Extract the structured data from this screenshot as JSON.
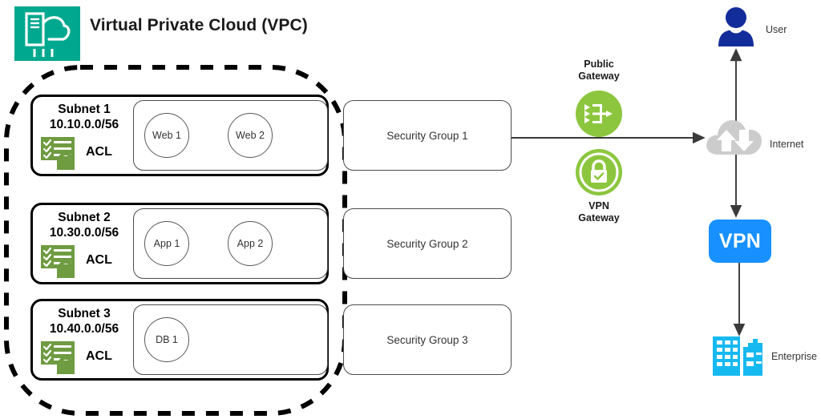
{
  "diagram": {
    "title": "Virtual Private Cloud (VPC)",
    "vpc_icon": "vpc-cloud-server-icon",
    "colors": {
      "vpc_teal": "#00A88F",
      "gateway_green": "#8CC63E",
      "acl_green": "#6F9B41",
      "vpn_blue": "#1890FF",
      "user_navy": "#122C9A",
      "enterprise_cyan": "#16B9F0",
      "internet_gray": "#CCCCCC",
      "stroke_black": "#000000"
    },
    "subnets": [
      {
        "name": "Subnet 1",
        "cidr": "10.10.0.0/56",
        "acl_label": "ACL",
        "acl_icon": "acl-checklist-lock-icon",
        "instances": [
          "Web 1",
          "Web 2"
        ],
        "security_group": "Security Group 1"
      },
      {
        "name": "Subnet 2",
        "cidr": "10.30.0.0/56",
        "acl_label": "ACL",
        "acl_icon": "acl-checklist-lock-icon",
        "instances": [
          "App 1",
          "App 2"
        ],
        "security_group": "Security Group 2"
      },
      {
        "name": "Subnet 3",
        "cidr": "10.40.0.0/56",
        "acl_label": "ACL",
        "acl_icon": "acl-checklist-lock-icon",
        "instances": [
          "DB 1"
        ],
        "security_group": "Security Group 3"
      }
    ],
    "gateways": [
      {
        "label_line1": "Public",
        "label_line2": "Gateway",
        "icon": "public-gateway-icon"
      },
      {
        "label_line1": "VPN",
        "label_line2": "Gateway",
        "icon": "vpn-gateway-lock-icon"
      }
    ],
    "external": {
      "user": {
        "label": "User",
        "icon": "user-person-icon"
      },
      "internet": {
        "label": "Internet",
        "icon": "internet-cloud-icon"
      },
      "vpn": {
        "label": "VPN",
        "icon": "vpn-box"
      },
      "enterprise": {
        "label": "Enterprise",
        "icon": "enterprise-buildings-icon"
      }
    }
  }
}
